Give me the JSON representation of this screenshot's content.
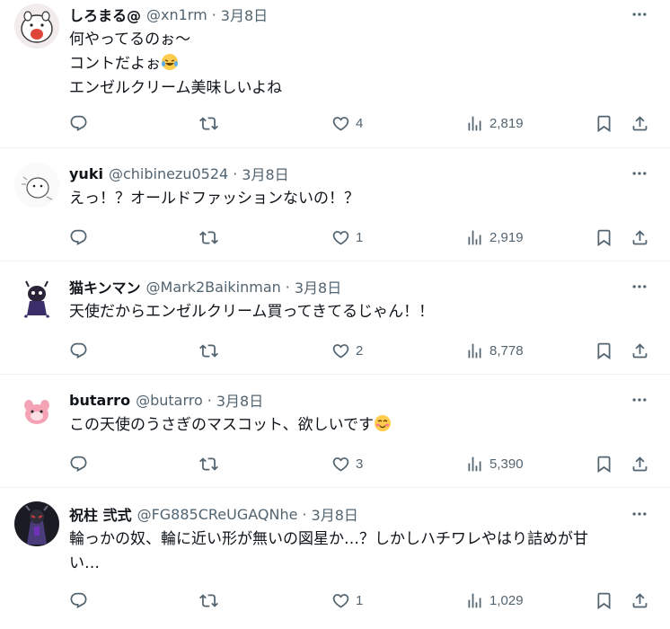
{
  "tweets": [
    {
      "name": "しろまる@",
      "handle": "@xn1rm",
      "dot": "·",
      "date": "3月8日",
      "lines": [
        "何やってるのぉ～",
        "コントだよぉ",
        "エンゼルクリーム美味しいよね"
      ],
      "emoji_after_line": 1,
      "emoji": "laughing-crying-emoji",
      "likes": "4",
      "views": "2,819"
    },
    {
      "name": "yuki",
      "handle": "@chibinezu0524",
      "dot": "·",
      "date": "3月8日",
      "lines": [
        "えっ！？オールドファッションないの！？"
      ],
      "likes": "1",
      "views": "2,919"
    },
    {
      "name": "猫キンマン",
      "handle": "@Mark2Baikinman",
      "dot": "·",
      "date": "3月8日",
      "lines": [
        "天使だからエンゼルクリーム買ってきてるじゃん！！"
      ],
      "likes": "2",
      "views": "8,778"
    },
    {
      "name": "butarro",
      "handle": "@butarro",
      "dot": "·",
      "date": "3月8日",
      "lines": [
        "この天使のうさぎのマスコット、欲しいです"
      ],
      "emoji_after_line": 0,
      "emoji": "smiling-blush-emoji",
      "likes": "3",
      "views": "5,390"
    },
    {
      "name": "祝柱 弐式",
      "handle": "@FG885CReUGAQNhe",
      "dot": "·",
      "date": "3月8日",
      "lines": [
        "輪っかの奴、輪に近い形が無いの図星か…？しかしハチワレやはり詰めが甘",
        "い…"
      ],
      "likes": "1",
      "views": "1,029"
    }
  ],
  "colors": {
    "text": "#0f1419",
    "secondary": "#536471",
    "border": "#eff3f4"
  }
}
